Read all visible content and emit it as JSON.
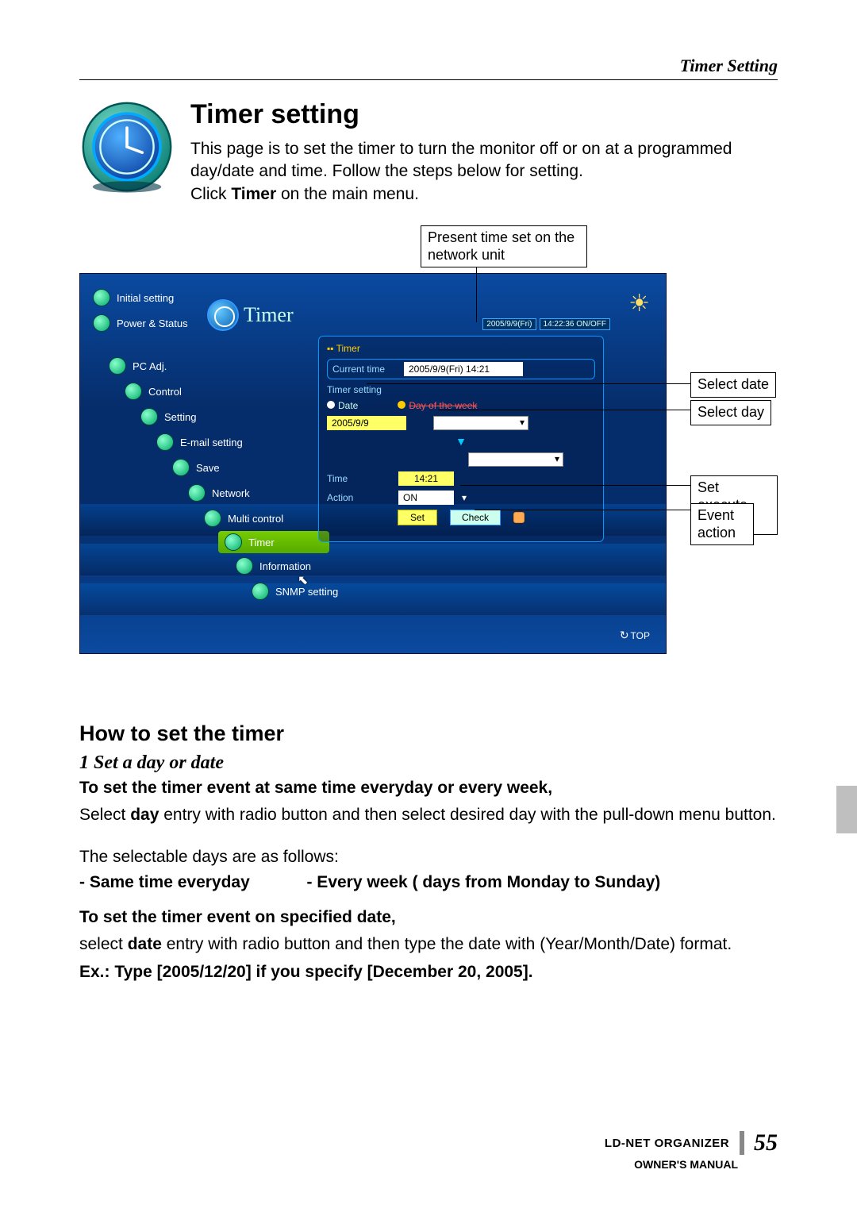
{
  "header": {
    "section": "Timer Setting"
  },
  "title": "Timer setting",
  "intro": {
    "p1": "This page is to set the timer to turn the monitor off or on at a programmed day/date and time. Follow the steps below for setting.",
    "p2a": "Click ",
    "p2b": "Timer",
    "p2c": " on the main menu."
  },
  "callouts": {
    "present_time": "Present time set on the network unit",
    "select_date": "Select date",
    "select_day": "Select day",
    "set_exec": "Set execute time",
    "event_action": "Event action"
  },
  "menu": {
    "items": [
      "Initial setting",
      "Power & Status",
      "PC Adj.",
      "Control",
      "Setting",
      "E-mail setting",
      "Save",
      "Network",
      "Multi control",
      "Timer",
      "Information",
      "SNMP setting"
    ],
    "heading": "Timer"
  },
  "status_bar": {
    "date": "2005/9/9(Fri)",
    "time_mode": "14:22:36  ON/OFF"
  },
  "panel": {
    "title": "Timer",
    "current_label": "Current time",
    "current_value": "2005/9/9(Fri) 14:21",
    "timer_setting_label": "Timer setting",
    "date_label": "Date",
    "day_label": "Day of the week",
    "date_value": "2005/9/9",
    "time_label": "Time",
    "time_value": "14:21",
    "action_label": "Action",
    "action_value": "ON",
    "set_btn": "Set",
    "check_btn": "Check",
    "top_btn": "TOP"
  },
  "howto": {
    "heading": "How to set the timer",
    "step1_title": "Set a day or date",
    "step1_num": "1",
    "sub1": "To set the timer event at same time everyday or every week,",
    "p1a": "Select ",
    "p1b": "day",
    "p1c": " entry with radio button and then select desired day with the pull-down menu button.",
    "p2": "The selectable days are as follows:",
    "opt1_label": "- Same time everyday",
    "opt2_label": "- Every week ( days from Monday to Sunday)",
    "sub2": "To set the timer event on specified date,",
    "p3a": "select ",
    "p3b": "date",
    "p3c": " entry with radio button and then type the date with (Year/Month/Date) format.",
    "ex": "Ex.: Type [2005/12/20] if you specify [December 20, 2005]."
  },
  "footer": {
    "product": "LD-NET ORGANIZER",
    "page": "55",
    "owners": "OWNER'S MANUAL"
  }
}
